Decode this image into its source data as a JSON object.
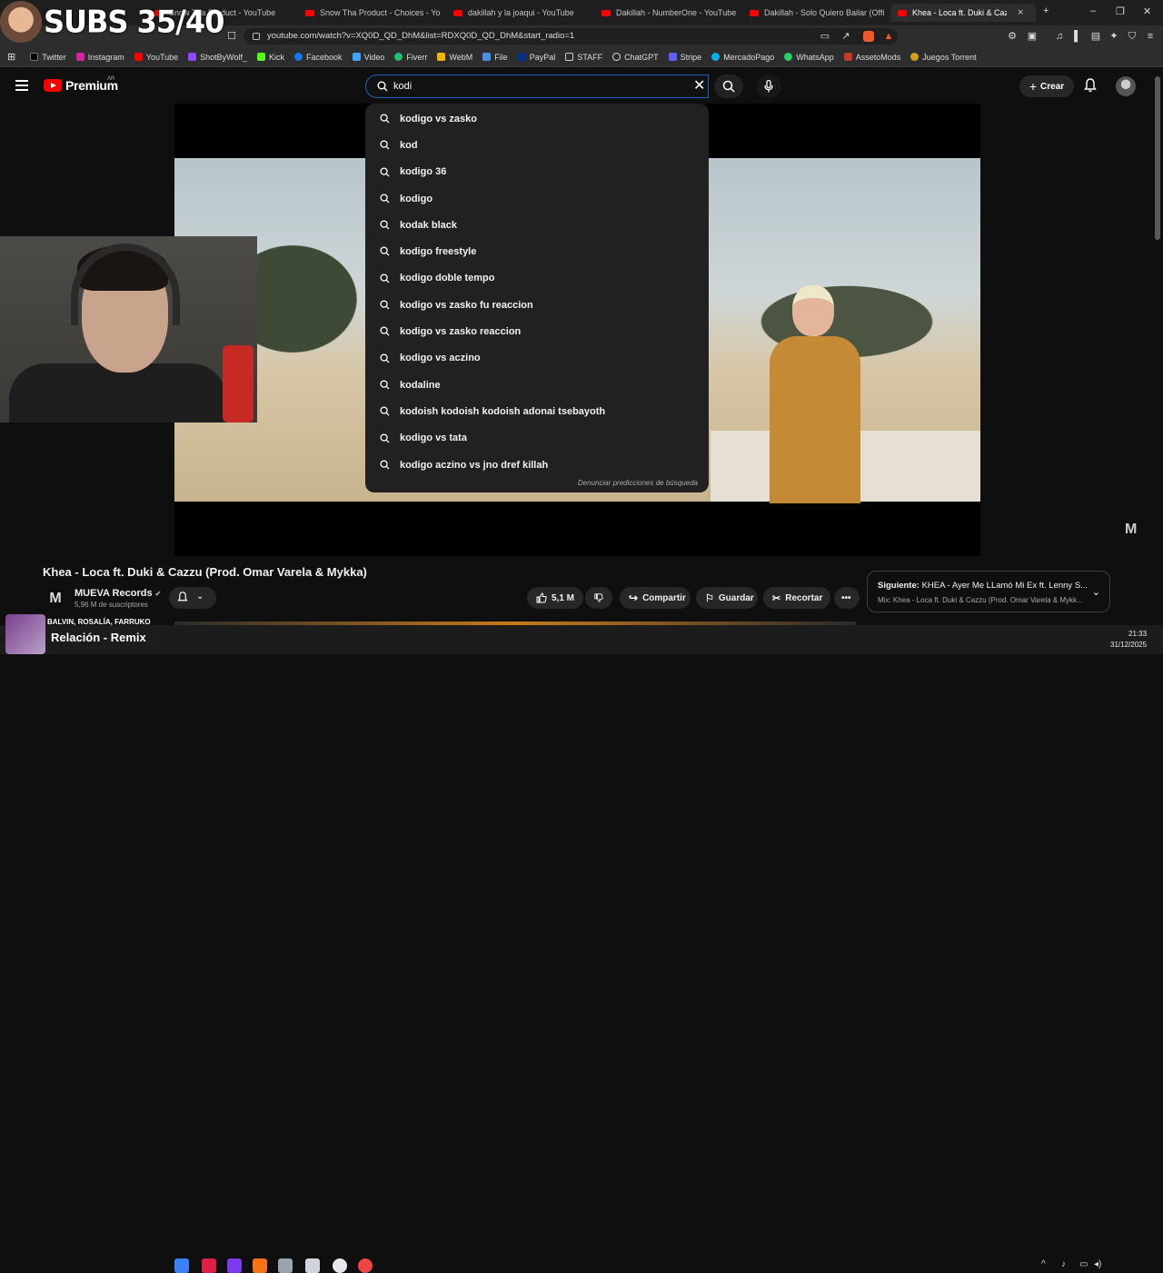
{
  "overlay": {
    "subs_text": "SUBS 35/40"
  },
  "browser": {
    "tabs": [
      {
        "label": "Snow Tha Product - YouTube"
      },
      {
        "label": "Snow Tha Product - Choices - YouTu"
      },
      {
        "label": "dakillah y la joaqui - YouTube"
      },
      {
        "label": "Dakillah - NumberOne - YouTube"
      },
      {
        "label": "Dakillah - Solo Quiero Bailar (Official"
      },
      {
        "label": "Khea - Loca ft. Duki & Cazzu"
      }
    ],
    "url": "youtube.com/watch?v=XQ0D_QD_DhM&list=RDXQ0D_QD_DhM&start_radio=1",
    "bookmarks": [
      {
        "label": "Twitter",
        "color": "#000000"
      },
      {
        "label": "Instagram",
        "color": "#d6249f"
      },
      {
        "label": "YouTube",
        "color": "#ff0000"
      },
      {
        "label": "ShotByWolf_",
        "color": "#9146ff"
      },
      {
        "label": "Kick",
        "color": "#53fc18"
      },
      {
        "label": "Facebook",
        "color": "#1877f2"
      },
      {
        "label": "Video",
        "color": "#3ea6ff"
      },
      {
        "label": "Fiverr",
        "color": "#1dbf73"
      },
      {
        "label": "WebM",
        "color": "#f4b400"
      },
      {
        "label": "File",
        "color": "#4a90e2"
      },
      {
        "label": "PayPal",
        "color": "#003087"
      },
      {
        "label": "STAFF",
        "color": "#888888"
      },
      {
        "label": "ChatGPT",
        "color": "#ffffff"
      },
      {
        "label": "Stripe",
        "color": "#635bff"
      },
      {
        "label": "MercadoPago",
        "color": "#00b1ea"
      },
      {
        "label": "WhatsApp",
        "color": "#25d366"
      },
      {
        "label": "AssetoMods",
        "color": "#c0392b"
      },
      {
        "label": "Juegos Torrent",
        "color": "#d4a017"
      }
    ]
  },
  "youtube": {
    "logo_text": "Premium",
    "logo_country": "AR",
    "search_value": "kodi",
    "create_label": "Crear",
    "suggestions": [
      "kodigo vs zasko",
      "kod",
      "kodigo 36",
      "kodigo",
      "kodak black",
      "kodigo freestyle",
      "kodigo doble tempo",
      "kodigo vs zasko fu reaccion",
      "kodigo vs zasko reaccion",
      "kodigo vs aczino",
      "kodaline",
      "kodoish kodoish kodoish adonai tsebayoth",
      "kodigo vs tata",
      "kodigo aczino vs jno dref killah"
    ],
    "report_label": "Denunciar predicciones de búsqueda",
    "video_title": "Khea - Loca ft. Duki & Cazzu (Prod. Omar Varela & Mykka)",
    "channel_name": "MUEVA Records",
    "channel_subs": "5,96 M de suscriptores",
    "likes": "5,1 M",
    "share_label": "Compartir",
    "save_label": "Guardar",
    "clip_label": "Recortar",
    "next_label": "Siguiente:",
    "next_title": "KHEA - Ayer Me LLamó Mi Ex ft. Lenny S...",
    "next_mix": "Mix: Khea - Loca ft. Duki & Cazzu (Prod. Omar Varela & Mykk..."
  },
  "now_playing": {
    "artist": "BALVIN, ROSALÍA, FARRUKO",
    "song": "Relación - Remix"
  },
  "taskbar": {
    "time": "21:33",
    "date": "31/12/2025"
  }
}
